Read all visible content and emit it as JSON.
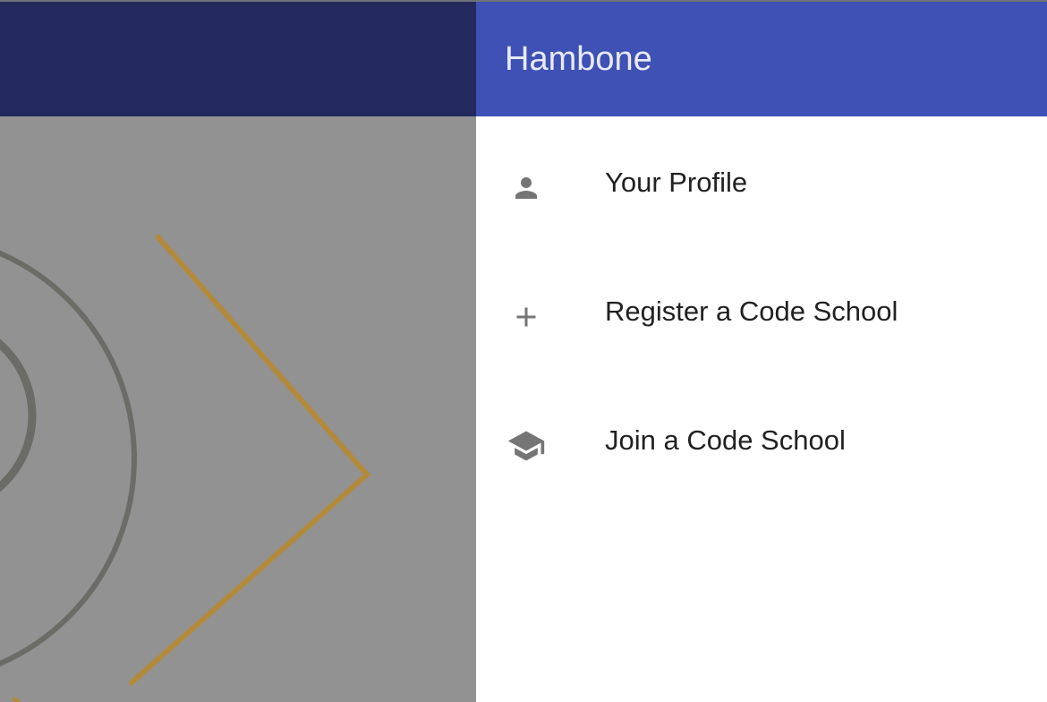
{
  "drawer": {
    "title": "Hambone",
    "items": [
      {
        "label": "Your Profile",
        "icon": "person-icon"
      },
      {
        "label": "Register a Code School",
        "icon": "plus-icon"
      },
      {
        "label": "Join a Code School",
        "icon": "school-icon"
      }
    ]
  },
  "colors": {
    "drawer_header": "#3f51b5",
    "app_bar_dimmed": "#23295c",
    "scrim_content": "#929292",
    "icon": "#757575",
    "text": "#212121",
    "arrow_accent": "#b38a3c"
  }
}
